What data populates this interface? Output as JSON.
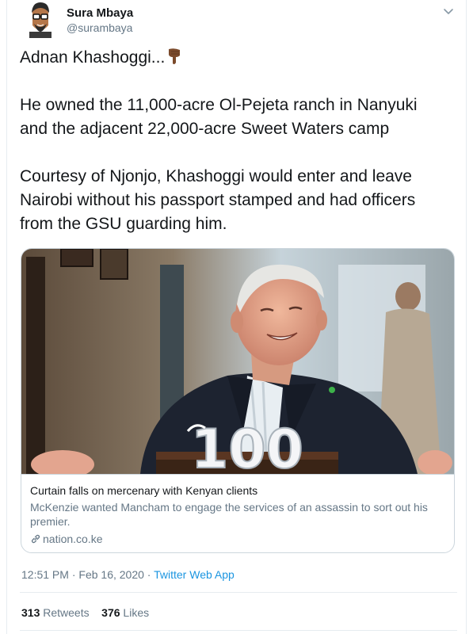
{
  "user": {
    "name": "Sura Mbaya",
    "handle": "@surambaya"
  },
  "tweet": {
    "line1": "Adnan Khashoggi...",
    "para1_line1": "He owned the 11,000-acre Ol-Pejeta ranch in Nanyuki",
    "para1_line2": "and the adjacent 22,000-acre Sweet Waters camp",
    "para2_line1": "Courtesy of Njonjo, Khashoggi would enter and leave",
    "para2_line2": "Nairobi without his passport stamped and had officers",
    "para2_line3": "from the GSU guarding him."
  },
  "card": {
    "cake_number": "100",
    "title": "Curtain falls on mercenary with Kenyan clients",
    "description": "McKenzie wanted Mancham to engage the services of an assassin to sort out his premier.",
    "domain": "nation.co.ke"
  },
  "meta": {
    "time": "12:51 PM",
    "separator": " · ",
    "date": "Feb 16, 2020",
    "app": "Twitter Web App"
  },
  "stats": {
    "retweets_count": "313",
    "retweets_label": "Retweets",
    "likes_count": "376",
    "likes_label": "Likes"
  },
  "icons": {
    "avatar": "cartoon-avatar",
    "menu": "chevron-down-icon",
    "emoji": "pointing-down-emoji",
    "link": "link-icon"
  },
  "colors": {
    "text": "#14171a",
    "secondary": "#657786",
    "accent": "#1b95e0",
    "border": "#ccd6dd"
  }
}
